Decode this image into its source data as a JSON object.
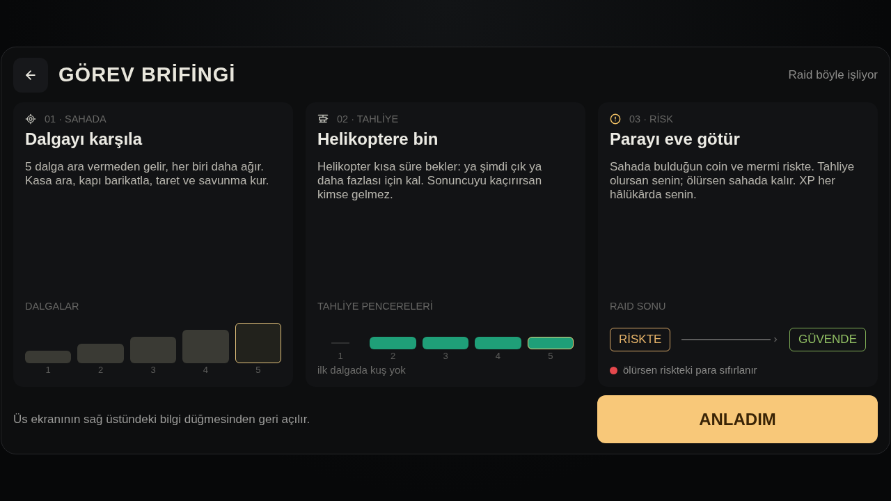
{
  "header": {
    "title": "GÖREV BRİFİNGİ",
    "link": "Raid böyle işliyor"
  },
  "cards": [
    {
      "kind": "waves",
      "eyebrow": "01 · SAHADA",
      "title": "Dalgayı karşıla",
      "description": "5 dalga ara vermeden gelir, her biri daha ağır. Kasa ara, kapı barikatla, taret ve savunma kur.",
      "section_label": "DALGALAR",
      "bars": [
        {
          "label": "1",
          "highlighted": false
        },
        {
          "label": "2",
          "highlighted": false
        },
        {
          "label": "3",
          "highlighted": false
        },
        {
          "label": "4",
          "highlighted": false
        },
        {
          "label": "5",
          "highlighted": true
        }
      ]
    },
    {
      "kind": "windows",
      "eyebrow": "02 · TAHLİYE",
      "title": "Helikoptere bin",
      "description": "Helikopter kısa süre bekler: ya şimdi çık ya daha fazlası için kal. Sonuncuyu kaçırırsan kimse gelmez.",
      "section_label": "TAHLİYE PENCERELERİ",
      "bars": [
        {
          "label": "1",
          "open": false,
          "highlighted": false
        },
        {
          "label": "2",
          "open": true,
          "highlighted": false
        },
        {
          "label": "3",
          "open": true,
          "highlighted": false
        },
        {
          "label": "4",
          "open": true,
          "highlighted": false
        },
        {
          "label": "5",
          "open": true,
          "highlighted": true
        }
      ],
      "note": "ilk dalgada kuş yok"
    },
    {
      "kind": "outcome",
      "eyebrow": "03 · RİSK",
      "title": "Parayı eve götür",
      "description": "Sahada bulduğun coin ve mermi riskte. Tahliye olursan senin; ölürsen sahada kalır. XP her hâlükârda senin.",
      "section_label": "RAID SONU",
      "from_state": "RİSKTE",
      "to_state": "GÜVENDE",
      "note": "ölürsen riskteki para sıfırlanır"
    }
  ],
  "footer": {
    "hint": "Üs ekranının sağ üstündeki bilgi düğmesinden geri açılır.",
    "button": "ANLADIM"
  }
}
